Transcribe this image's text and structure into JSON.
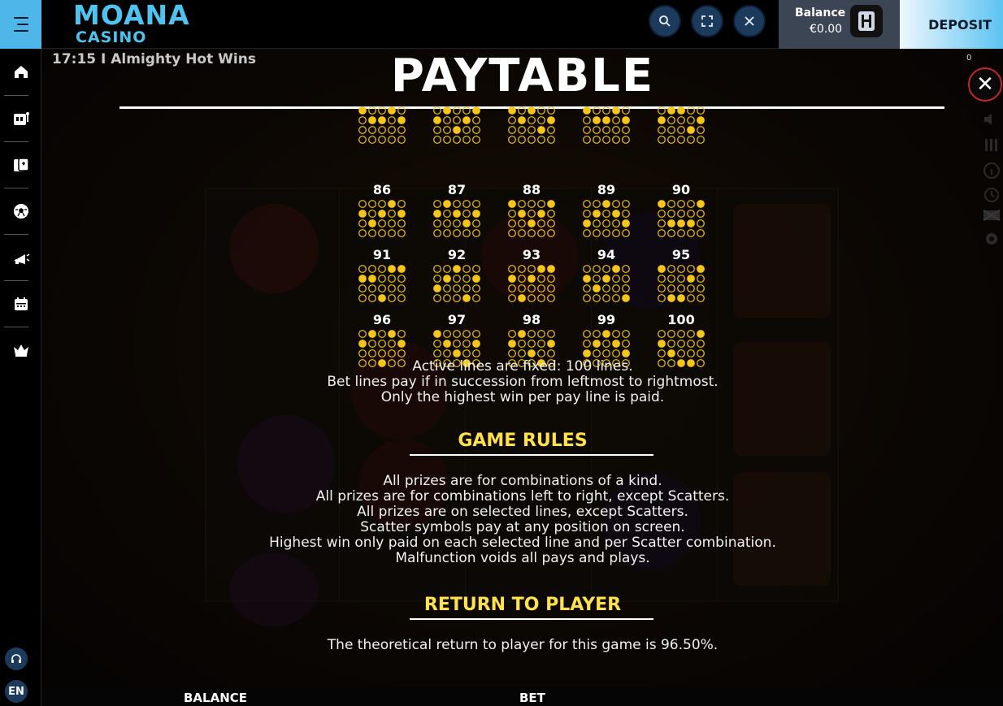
{
  "header": {
    "logo_top": "MOANA",
    "logo_bottom": "CASINO",
    "balance_label": "Balance",
    "balance_value": "€0.00",
    "deposit_label": "DEPOSIT",
    "menu_icon": "hamburger-icon",
    "search_icon": "search-icon",
    "fullscreen_icon": "fullscreen-icon",
    "close_icon": "close-icon",
    "avatar_icon": "user-avatar-icon"
  },
  "sidebar": {
    "items": [
      {
        "icon": "home-icon"
      },
      {
        "icon": "slot-machine-icon"
      },
      {
        "icon": "live-casino-icon"
      },
      {
        "icon": "sports-icon"
      },
      {
        "icon": "promotions-icon"
      },
      {
        "icon": "calendar-icon"
      },
      {
        "icon": "vip-crown-icon"
      }
    ],
    "support_icon": "headset-icon",
    "language": "EN"
  },
  "game": {
    "title": "17:15 I Almighty Hot Wins",
    "counter": "0",
    "paytable_title": "PAYTABLE",
    "close_symbol": "✕"
  },
  "lines": [
    {
      "num": "86",
      "pattern": [
        1,
        2,
        1,
        0,
        1
      ]
    },
    {
      "num": "87",
      "pattern": [
        1,
        0,
        1,
        2,
        1
      ]
    },
    {
      "num": "88",
      "pattern": [
        0,
        1,
        2,
        1,
        0
      ]
    },
    {
      "num": "89",
      "pattern": [
        2,
        1,
        0,
        1,
        2
      ]
    },
    {
      "num": "90",
      "pattern": [
        0,
        2,
        2,
        2,
        0
      ]
    },
    {
      "num": "91",
      "pattern": [
        1,
        1,
        3,
        0,
        0
      ]
    },
    {
      "num": "92",
      "pattern": [
        2,
        1,
        0,
        3,
        1
      ]
    },
    {
      "num": "93",
      "pattern": [
        1,
        3,
        1,
        0,
        0
      ]
    },
    {
      "num": "94",
      "pattern": [
        1,
        2,
        1,
        0,
        3
      ]
    },
    {
      "num": "95",
      "pattern": [
        0,
        3,
        3,
        1,
        0
      ]
    },
    {
      "num": "96",
      "pattern": [
        1,
        0,
        3,
        0,
        1
      ]
    },
    {
      "num": "97",
      "pattern": [
        0,
        1,
        2,
        3,
        1
      ]
    },
    {
      "num": "98",
      "pattern": [
        1,
        0,
        2,
        3,
        1
      ]
    },
    {
      "num": "99",
      "pattern": [
        2,
        1,
        0,
        1,
        2
      ]
    },
    {
      "num": "100",
      "pattern": [
        1,
        2,
        3,
        3,
        0
      ]
    }
  ],
  "partial_row_pattern": [
    [
      0,
      1,
      1,
      0,
      1
    ],
    [
      1,
      0,
      2,
      1,
      0
    ],
    [
      0,
      1,
      0,
      2,
      1
    ],
    [
      0,
      1,
      1,
      0,
      1
    ],
    [
      1,
      0,
      0,
      2,
      1
    ]
  ],
  "info": {
    "line1": "Active lines are fixed: 100 lines.",
    "line2": "Bet lines pay if in succession from leftmost to rightmost.",
    "line3": "Only the highest win per pay line is paid."
  },
  "game_rules": {
    "title": "GAME RULES",
    "lines": [
      "All prizes are for combinations of a kind.",
      "All prizes are for combinations left to right, except Scatters.",
      "All prizes are on selected lines, except Scatters.",
      "Scatter symbols pay at any position on screen.",
      "Highest win only paid on each selected line and per Scatter combination.",
      "Malfunction voids all pays and plays."
    ]
  },
  "rtp": {
    "title": "RETURN TO PLAYER",
    "text": "The theoretical return to player for this game is 96.50%."
  },
  "footer": {
    "balance_label": "BALANCE",
    "bet_label": "BET"
  },
  "colors": {
    "accent": "#4fc3f0",
    "gold": "#ffe14a",
    "dot_on": "#f5c518",
    "close_ring": "#c0252b"
  }
}
